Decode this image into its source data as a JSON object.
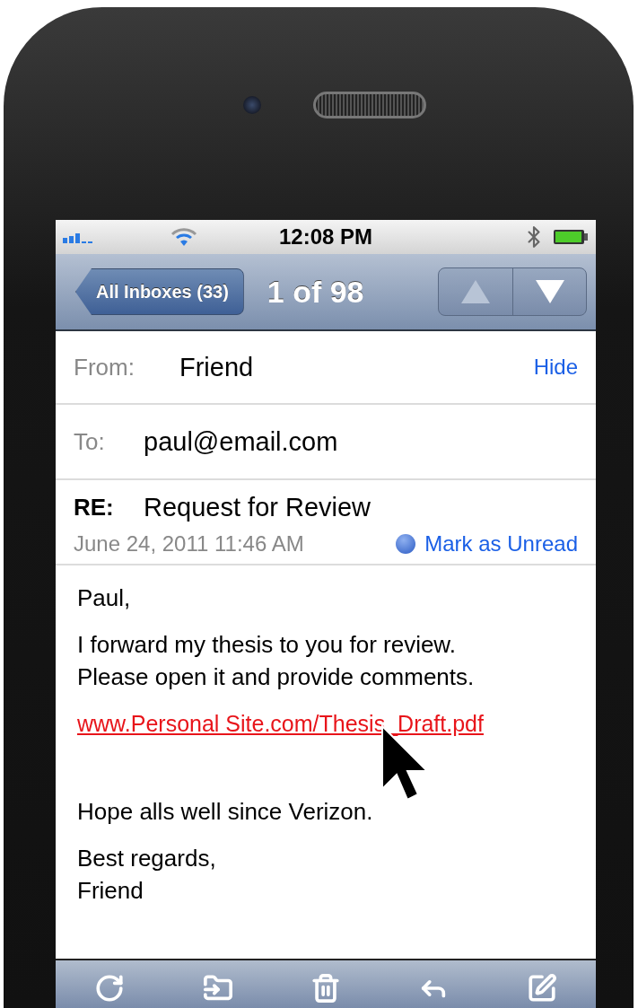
{
  "status_bar": {
    "time": "12:08 PM"
  },
  "nav_bar": {
    "back_button": "All Inboxes (33)",
    "title": "1 of 98",
    "arrows": [
      {
        "kind": "up",
        "disabled": true
      },
      {
        "kind": "down",
        "disabled": false
      }
    ]
  },
  "header": {
    "from_label": "From:",
    "from": "Friend",
    "hide": "Hide",
    "to_label": "To:",
    "to": "paul@email.com",
    "subject_label": "RE:",
    "subject": "Request for Review",
    "date": "June 24, 2011 11:46 AM",
    "mark_unread": "Mark as Unread"
  },
  "body": [
    {
      "kind": "text",
      "lines": [
        "Paul,"
      ]
    },
    {
      "kind": "text",
      "lines": [
        "I forward my thesis to you for review.",
        "Please open it and provide comments."
      ]
    },
    {
      "kind": "link",
      "lines": [
        "www.Personal Site.com/Thesis_Draft.pdf"
      ]
    },
    {
      "kind": "spacer"
    },
    {
      "kind": "text",
      "lines": [
        "Hope alls well since Verizon."
      ]
    },
    {
      "kind": "text",
      "lines": [
        "Best regards,",
        "Friend"
      ]
    }
  ],
  "toolbar": [
    {
      "kind": "refresh"
    },
    {
      "kind": "move"
    },
    {
      "kind": "trash"
    },
    {
      "kind": "reply"
    },
    {
      "kind": "compose"
    }
  ]
}
